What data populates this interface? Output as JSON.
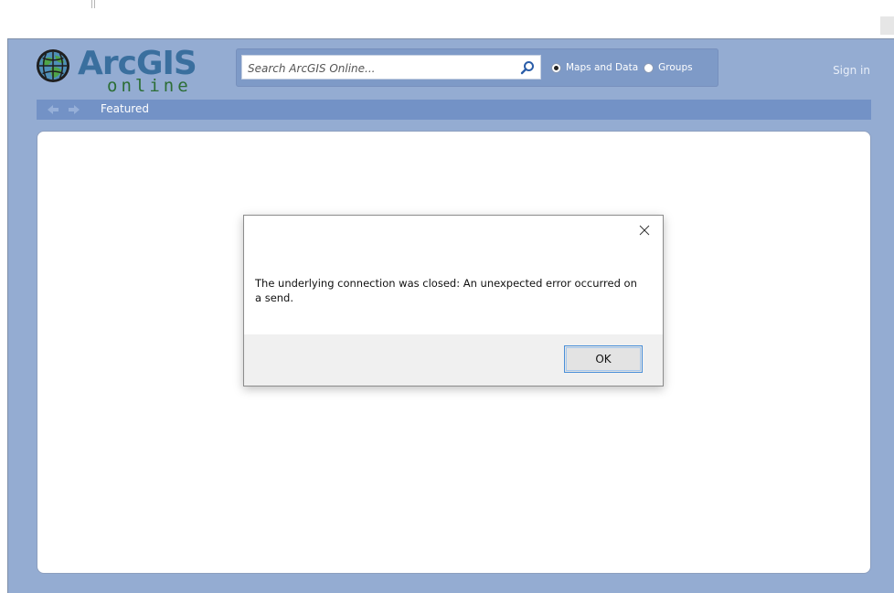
{
  "header": {
    "logo_main": "ArcGIS",
    "logo_sub": "online",
    "sign_in": "Sign in"
  },
  "search": {
    "placeholder": "Search ArcGIS Online...",
    "value": ""
  },
  "scope": {
    "options": [
      {
        "label": "Maps and Data",
        "selected": true
      },
      {
        "label": "Groups",
        "selected": false
      }
    ]
  },
  "nav": {
    "title": "Featured"
  },
  "dialog": {
    "message": "The underlying connection was closed: An unexpected error occurred on a send.",
    "ok_label": "OK"
  },
  "colors": {
    "window_bg": "#94acd2",
    "navbar_bg": "#7392c6",
    "logo_blue": "#3a6f9e",
    "logo_green": "#2c6e36",
    "focus_blue": "#4a8fd8"
  },
  "icons": [
    "globe-icon",
    "search-icon",
    "back-arrow-icon",
    "forward-arrow-icon",
    "close-icon"
  ]
}
